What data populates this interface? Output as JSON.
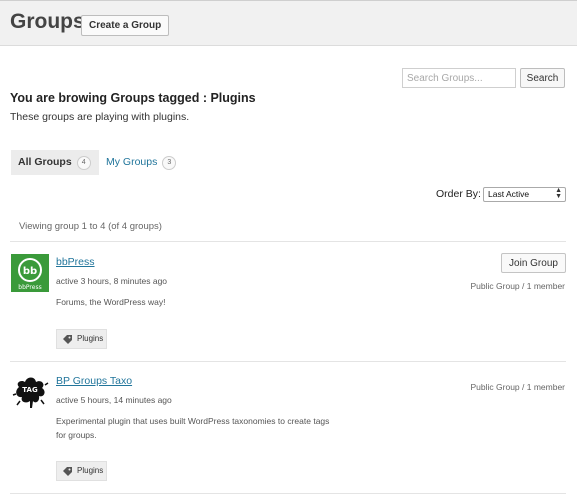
{
  "header": {
    "title": "Groups",
    "create_label": "Create a Group"
  },
  "search": {
    "placeholder": "Search Groups...",
    "button_label": "Search"
  },
  "tag_section": {
    "heading": "You are browing Groups tagged : Plugins",
    "description": "These groups are playing with plugins."
  },
  "tabs": [
    {
      "label": "All Groups",
      "count": "4",
      "active": true
    },
    {
      "label": "My Groups",
      "count": "3",
      "active": false
    }
  ],
  "order_by": {
    "label": "Order By:",
    "selected": "Last Active"
  },
  "pagination": {
    "viewing_text": "Viewing group 1 to 4 (of 4 groups)"
  },
  "groups": [
    {
      "name": "bbPress",
      "active": "active 3 hours, 8 minutes ago",
      "description": "Forums, the WordPress way!",
      "tag": "Plugins",
      "meta": "Public Group / 1 member",
      "join_label": "Join Group",
      "avatar_text": "bbPress",
      "avatar_color": "#3a9a3a"
    },
    {
      "name": "BP Groups Taxo",
      "active": "active 5 hours, 14 minutes ago",
      "description": "Experimental plugin that uses built WordPress taxonomies to create tags for groups.",
      "tag": "Plugins",
      "meta": "Public Group / 1 member",
      "avatar_text": "TAG"
    }
  ],
  "colors": {
    "link": "#21759b",
    "header_bg": "#f1f1f1"
  }
}
